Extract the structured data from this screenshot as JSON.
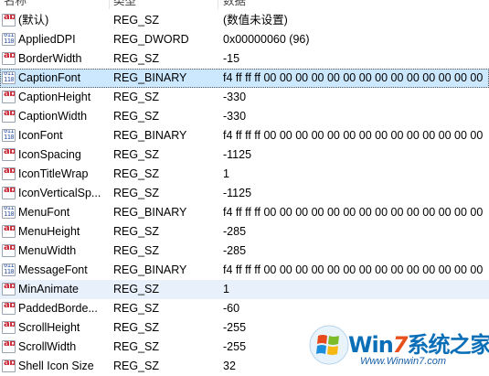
{
  "columns": {
    "name": "名称",
    "type": "类型",
    "data": "数据"
  },
  "icons": {
    "string": "ab-string-icon",
    "binary": "binary-value-icon"
  },
  "rows": [
    {
      "name": "(默认)",
      "type": "REG_SZ",
      "data": "(数值未设置)",
      "icon": "string"
    },
    {
      "name": "AppliedDPI",
      "type": "REG_DWORD",
      "data": "0x00000060 (96)",
      "icon": "binary"
    },
    {
      "name": "BorderWidth",
      "type": "REG_SZ",
      "data": "-15",
      "icon": "string"
    },
    {
      "name": "CaptionFont",
      "type": "REG_BINARY",
      "data": "f4 ff ff ff 00 00 00 00 00 00 00 00 00 00 00 00 00 00",
      "icon": "binary",
      "state": "selected"
    },
    {
      "name": "CaptionHeight",
      "type": "REG_SZ",
      "data": "-330",
      "icon": "string"
    },
    {
      "name": "CaptionWidth",
      "type": "REG_SZ",
      "data": "-330",
      "icon": "string"
    },
    {
      "name": "IconFont",
      "type": "REG_BINARY",
      "data": "f4 ff ff ff 00 00 00 00 00 00 00 00 00 00 00 00 00 00",
      "icon": "binary"
    },
    {
      "name": "IconSpacing",
      "type": "REG_SZ",
      "data": "-1125",
      "icon": "string"
    },
    {
      "name": "IconTitleWrap",
      "type": "REG_SZ",
      "data": "1",
      "icon": "string"
    },
    {
      "name": "IconVerticalSp...",
      "type": "REG_SZ",
      "data": "-1125",
      "icon": "string"
    },
    {
      "name": "MenuFont",
      "type": "REG_BINARY",
      "data": "f4 ff ff ff 00 00 00 00 00 00 00 00 00 00 00 00 00 00",
      "icon": "binary"
    },
    {
      "name": "MenuHeight",
      "type": "REG_SZ",
      "data": "-285",
      "icon": "string"
    },
    {
      "name": "MenuWidth",
      "type": "REG_SZ",
      "data": "-285",
      "icon": "string"
    },
    {
      "name": "MessageFont",
      "type": "REG_BINARY",
      "data": "f4 ff ff ff 00 00 00 00 00 00 00 00 00 00 00 00 00 00",
      "icon": "binary"
    },
    {
      "name": "MinAnimate",
      "type": "REG_SZ",
      "data": "1",
      "icon": "string",
      "state": "hover"
    },
    {
      "name": "PaddedBorde...",
      "type": "REG_SZ",
      "data": "-60",
      "icon": "string"
    },
    {
      "name": "ScrollHeight",
      "type": "REG_SZ",
      "data": "-255",
      "icon": "string"
    },
    {
      "name": "ScrollWidth",
      "type": "REG_SZ",
      "data": "-255",
      "icon": "string"
    },
    {
      "name": "Shell Icon Size",
      "type": "REG_SZ",
      "data": "32",
      "icon": "string"
    }
  ],
  "watermark": {
    "title_a": "Win",
    "title_b": "7",
    "title_c": "系统之家",
    "url": "Www.Winwin7.com"
  }
}
